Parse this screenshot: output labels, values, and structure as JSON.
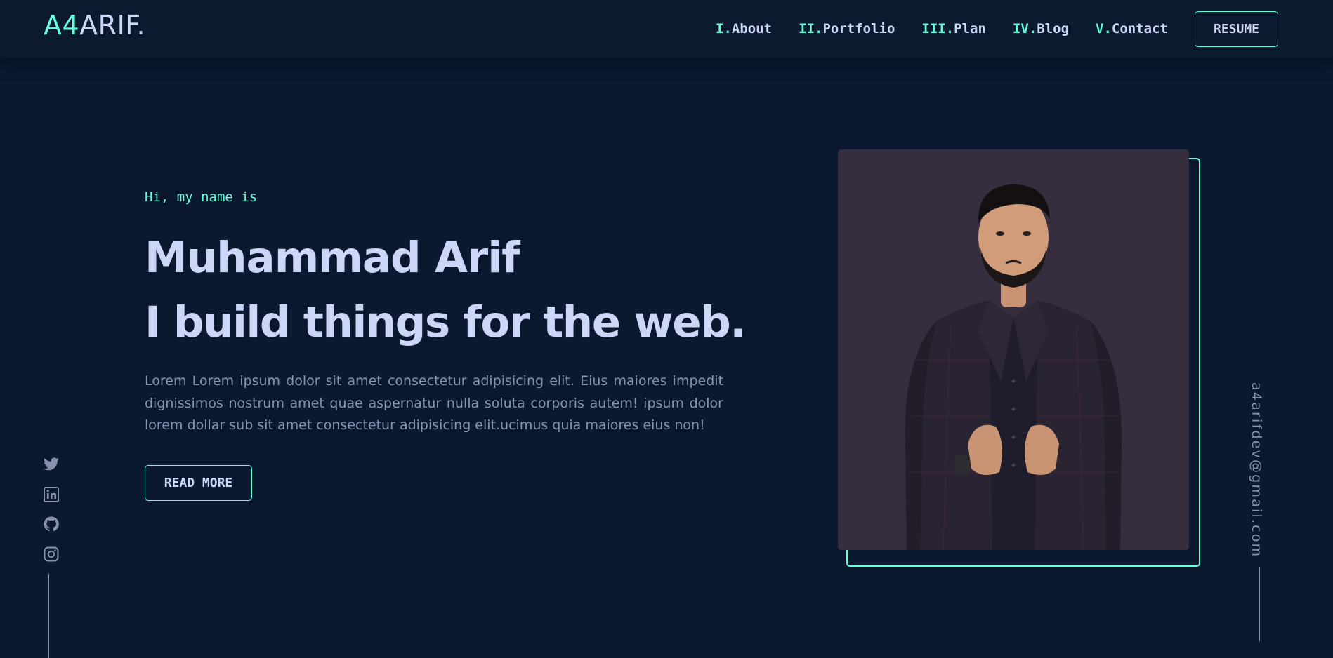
{
  "nav": {
    "logo_accent": "A4",
    "logo_rest": "ARIF.",
    "items": [
      {
        "num": "I.",
        "label": "About"
      },
      {
        "num": "II.",
        "label": "Portfolio"
      },
      {
        "num": "III.",
        "label": "Plan"
      },
      {
        "num": "IV.",
        "label": "Blog"
      },
      {
        "num": "V.",
        "label": "Contact"
      }
    ],
    "resume_label": "RESUME"
  },
  "hero": {
    "greeting": "Hi, my name is",
    "name": "Muhammad Arif",
    "tagline": "I build things for the web.",
    "description": "Lorem Lorem ipsum dolor sit amet consectetur adipisicing elit. Eius maiores impedit dignissimos nostrum amet quae aspernatur nulla soluta corporis autem! ipsum dolor lorem dollar sub sit amet consectetur adipisicing elit.ucimus quia maiores eius non!",
    "read_more_label": "READ MORE"
  },
  "photo": {
    "subject": "profile photo of a man in a dark checked blazer"
  },
  "social": {
    "icons": [
      "twitter-icon",
      "linkedin-icon",
      "github-icon",
      "instagram-icon"
    ]
  },
  "email": "a4arifdev@gmail.com",
  "colors": {
    "background": "#0a192f",
    "navbar": "#0c1a30",
    "accent": "#64ffda",
    "heading": "#ccd6f6",
    "body_text": "#8892b0",
    "photo_background": "#362e3e"
  }
}
